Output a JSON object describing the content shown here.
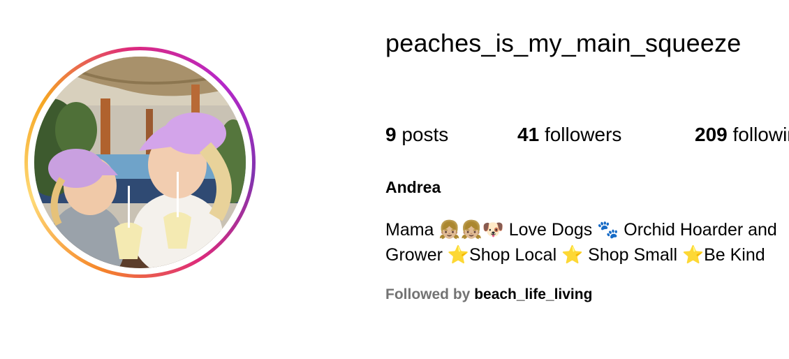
{
  "profile": {
    "username": "peaches_is_my_main_squeeze",
    "stats": {
      "posts_count": "9",
      "posts_label": "posts",
      "followers_count": "41",
      "followers_label": "followers",
      "following_count": "209",
      "following_label": "following"
    },
    "full_name": "Andrea",
    "bio_line_1": "Mama 👧🏼👧🏼🐶 Love Dogs 🐾 Orchid Hoarder and",
    "bio_line_2": "Grower ⭐Shop Local ⭐ Shop Small ⭐Be Kind",
    "followed_by_label": "Followed by",
    "followed_by_user": "beach_life_living"
  },
  "colors": {
    "ring_gradient": [
      "#f58529",
      "#feda77",
      "#dd2a7b",
      "#8134af"
    ],
    "muted_text": "#737373"
  }
}
